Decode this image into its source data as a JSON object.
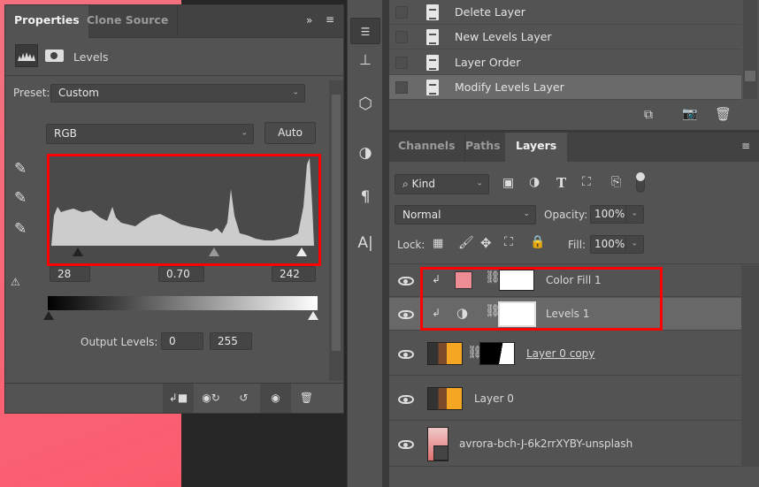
{
  "properties": {
    "tabs": [
      "Properties",
      "Clone Source"
    ],
    "adjustment_title": "Levels",
    "preset_label": "Preset:",
    "preset_value": "Custom",
    "channel_value": "RGB",
    "auto_label": "Auto",
    "input_black": "28",
    "input_gamma": "0.70",
    "input_white": "242",
    "output_label": "Output Levels:",
    "output_black": "0",
    "output_white": "255"
  },
  "history": {
    "items": [
      "Delete Layer",
      "New Levels Layer",
      "Layer Order",
      "Modify Levels Layer"
    ]
  },
  "layers_panel": {
    "tabs": [
      "Channels",
      "Paths",
      "Layers"
    ],
    "filter_value": "Kind",
    "blend_mode": "Normal",
    "opacity_label": "Opacity:",
    "opacity_value": "100%",
    "lock_label": "Lock:",
    "fill_label": "Fill:",
    "fill_value": "100%",
    "layers": [
      {
        "name": "Color Fill 1",
        "fill_color": "#ee8c96"
      },
      {
        "name": "Levels 1"
      },
      {
        "name": "Layer 0 copy"
      },
      {
        "name": "Layer 0"
      },
      {
        "name": "avrora-bch-J-6k2rrXYBY-unsplash"
      }
    ]
  },
  "colors": {
    "highlight": "#ff0000",
    "panel": "#535353"
  }
}
